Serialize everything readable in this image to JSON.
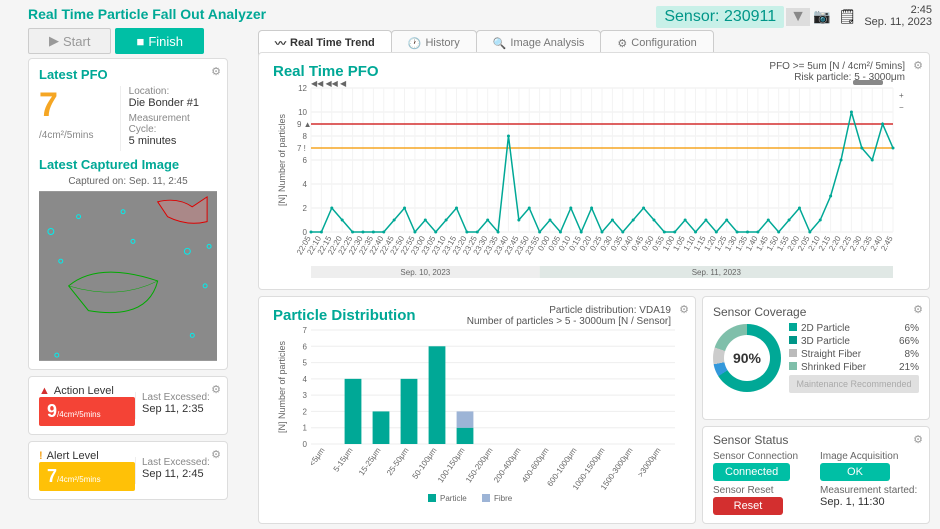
{
  "sensor": {
    "label": "Sensor: 230911"
  },
  "datetime": {
    "time": "2:45",
    "date": "Sep. 11, 2023"
  },
  "app_title": "Real Time Particle Fall Out Analyzer",
  "buttons": {
    "start": "Start",
    "finish": "Finish"
  },
  "latest_pfo": {
    "title": "Latest PFO",
    "value": "7",
    "unit": "/4cm²/5mins",
    "location_label": "Location:",
    "location": "Die Bonder #1",
    "cycle_label": "Measurement  Cycle:",
    "cycle": "5 minutes"
  },
  "captured": {
    "title": "Latest Captured Image",
    "sub": "Captured on: Sep. 11, 2:45"
  },
  "action": {
    "title": "Action Level",
    "value": "9",
    "unit": "/4cm²/5mins",
    "last_label": "Last Excessed:",
    "last": "Sep 11, 2:35"
  },
  "alert": {
    "title": "Alert Level",
    "value": "7",
    "unit": "/4cm²/5mins",
    "last_label": "Last Excessed:",
    "last": "Sep 11, 2:45"
  },
  "tabs": {
    "realtime": "Real Time  Trend",
    "history": "History",
    "image": "Image Analysis",
    "config": "Configuration"
  },
  "main_chart": {
    "title": "Real Time PFO",
    "sub1": "PFO >= 5um [N / 4cm²/  5mins]",
    "sub2": "Risk particle: 5 - 3000μm",
    "ylabel": "[N] Number of particles",
    "date1": "Sep. 10, 2023",
    "date2": "Sep. 11, 2023"
  },
  "dist": {
    "title": "Particle Distribution",
    "sub1": "Particle distribution: VDA19",
    "sub2": "Number of particles > 5 - 3000um [N / Sensor]",
    "ylabel": "[N] Number of particles",
    "legend_p": "Particle",
    "legend_f": "Fibre"
  },
  "coverage": {
    "title": "Sensor Coverage",
    "pct": "90%",
    "items": [
      {
        "name": "2D Particle",
        "val": "6%",
        "color": "#00a896"
      },
      {
        "name": "3D Particle",
        "val": "66%",
        "color": "#009688"
      },
      {
        "name": "Straight Fiber",
        "val": "8%",
        "color": "#bbb"
      },
      {
        "name": "Shrinked Fiber",
        "val": "21%",
        "color": "#7fbfaa"
      }
    ],
    "maint": "Maintenance Recommended"
  },
  "status": {
    "title": "Sensor Status",
    "conn_label": "Sensor Connection",
    "conn": "Connected",
    "img_label": "Image Acquisition",
    "img": "OK",
    "reset_label": "Sensor Reset",
    "reset": "Reset",
    "meas_label": "Measurement  started:",
    "meas": "Sep. 1, 11:30"
  },
  "chart_data": {
    "realtime_pfo": {
      "type": "line",
      "ylabel": "[N] Number of particles",
      "ylim": [
        0,
        12
      ],
      "action_line": 9,
      "alert_line": 7,
      "x": [
        "22:05",
        "22:10",
        "22:15",
        "22:20",
        "22:25",
        "22:30",
        "22:35",
        "22:40",
        "22:45",
        "22:50",
        "22:55",
        "23:00",
        "23:05",
        "23:10",
        "23:15",
        "23:20",
        "23:25",
        "23:30",
        "23:35",
        "23:40",
        "23:45",
        "23:50",
        "23:55",
        "0:00",
        "0:05",
        "0:10",
        "0:15",
        "0:20",
        "0:25",
        "0:30",
        "0:35",
        "0:40",
        "0:45",
        "0:50",
        "0:55",
        "1:00",
        "1:05",
        "1:10",
        "1:15",
        "1:20",
        "1:25",
        "1:30",
        "1:35",
        "1:40",
        "1:45",
        "1:50",
        "1:55",
        "2:00",
        "2:05",
        "2:10",
        "2:15",
        "2:20",
        "2:25",
        "2:30",
        "2:35",
        "2:40",
        "2:45"
      ],
      "values": [
        0,
        0,
        2,
        1,
        0,
        0,
        0,
        0,
        1,
        2,
        0,
        1,
        0,
        1,
        2,
        0,
        0,
        1,
        0,
        8,
        1,
        2,
        0,
        1,
        0,
        2,
        0,
        2,
        0,
        1,
        0,
        1,
        2,
        1,
        0,
        0,
        1,
        0,
        1,
        0,
        1,
        0,
        0,
        0,
        1,
        0,
        1,
        2,
        0,
        1,
        3,
        6,
        10,
        7,
        6,
        9,
        7
      ]
    },
    "particle_distribution": {
      "type": "bar",
      "ylabel": "[N] Number of particles",
      "ylim": [
        0,
        7
      ],
      "categories": [
        "<5μm",
        "5-15μm",
        "15-25μm",
        "25-50μm",
        "50-100μm",
        "100-150μm",
        "150-200μm",
        "200-400μm",
        "400-600μm",
        "600-1000μm",
        "1000-1500μm",
        "1500-3000μm",
        ">3000μm"
      ],
      "series": [
        {
          "name": "Particle",
          "values": [
            0,
            4,
            2,
            4,
            6,
            1,
            0,
            0,
            0,
            0,
            0,
            0,
            0
          ]
        },
        {
          "name": "Fibre",
          "values": [
            0,
            0,
            0,
            0,
            0,
            1,
            0,
            0,
            0,
            0,
            0,
            0,
            0
          ]
        }
      ]
    },
    "sensor_coverage": {
      "type": "pie",
      "total_pct": 90,
      "slices": [
        {
          "name": "2D Particle",
          "value": 6
        },
        {
          "name": "3D Particle",
          "value": 66
        },
        {
          "name": "Straight Fiber",
          "value": 8
        },
        {
          "name": "Shrinked Fiber",
          "value": 21
        }
      ]
    }
  }
}
